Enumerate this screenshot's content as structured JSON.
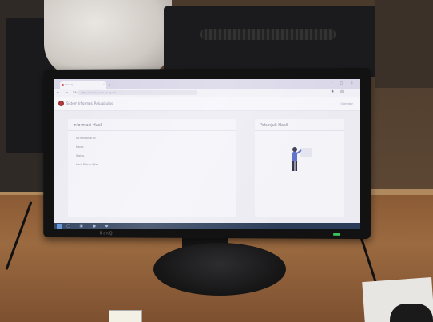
{
  "scene": {
    "monitor_brand": "BenQ"
  },
  "browser": {
    "tab_label": "Sirekap",
    "new_tab_glyph": "+",
    "address": "https://sirekap-web.kpu.go.id",
    "window_controls": "– ▢ ✕"
  },
  "app": {
    "title": "Sistem Informasi Rekapitulasi",
    "user_menu": "Operator"
  },
  "panel_left": {
    "title": "Informasi Hasil",
    "rows": [
      {
        "label": "No Pendaftaran",
        "value": ""
      },
      {
        "label": "Nama",
        "value": ""
      },
      {
        "label": "Status",
        "value": ""
      },
      {
        "label": "Hasil Pilihan Ujian",
        "value": ""
      }
    ]
  },
  "panel_right": {
    "title": "Petunjuk Hasil",
    "hint": ""
  },
  "taskbar": {
    "clock": ""
  },
  "colors": {
    "screen_bg": "#ecebf2",
    "taskbar": "#2c3d5a",
    "accent": "#5a8fd8"
  }
}
